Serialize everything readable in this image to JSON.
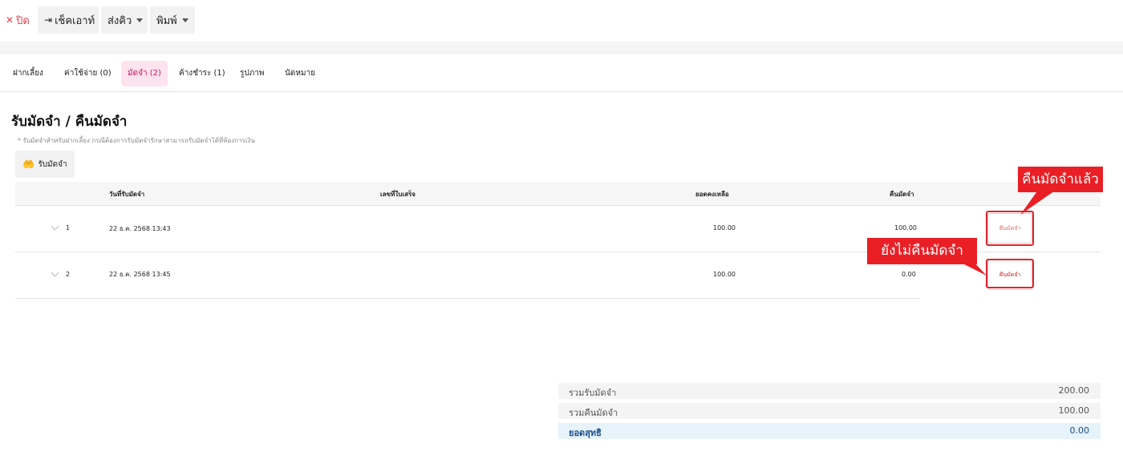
{
  "toolbar": {
    "close_label": "ปิด",
    "checkout_label": "เช็คเอาท์",
    "send_queue_label": "ส่งคิว",
    "print_label": "พิมพ์"
  },
  "tabs": [
    {
      "label": "ฝากเลี้ยง"
    },
    {
      "label": "ค่าใช้จ่าย (0)"
    },
    {
      "label": "มัดจำ (2)",
      "active": true
    },
    {
      "label": "ค้างชำระ (1)"
    },
    {
      "label": "รูปภาพ"
    },
    {
      "label": "นัดหมาย"
    }
  ],
  "section": {
    "title": "รับมัดจำ / คืนมัดจำ",
    "note": "* รับมัดจำสำหรับฝากเลี้ยง กรณีต้องการรับมัดจำรักษาสามารถรับมัดจำได้ที่ห้องการเงิน",
    "receive_button": "รับมัดจำ"
  },
  "table": {
    "headers": {
      "date": "วันที่รับมัดจำ",
      "receipt": "เลขที่ใบเสร็จ",
      "balance": "ยอดคงเหลือ",
      "returned": "คืนมัดจำ"
    },
    "rows": [
      {
        "index": "1",
        "date": "22 ธ.ค. 2568 13:43",
        "receipt": "",
        "balance": "100.00",
        "returned": "100.00",
        "action": "คืนมัดจำ"
      },
      {
        "index": "2",
        "date": "22 ธ.ค. 2568 13:45",
        "receipt": "",
        "balance": "100.00",
        "returned": "0.00",
        "action": "คืนมัดจำ"
      }
    ]
  },
  "annotations": {
    "returned": "คืนมัดจำแล้ว",
    "not_returned": "ยังไม่คืนมัดจำ"
  },
  "summary": {
    "total_received_label": "รวมรับมัดจำ",
    "total_received": "200.00",
    "total_returned_label": "รวมคืนมัดจำ",
    "total_returned": "100.00",
    "net_label": "ยอดสุทธิ",
    "net": "0.00"
  },
  "colors": {
    "active_tab_bg": "#fde3ee",
    "active_tab_text": "#c2185b",
    "annotation_red": "#ea1f26",
    "net_row_bg": "#e6f3fb",
    "net_row_text": "#1a4d8c"
  }
}
